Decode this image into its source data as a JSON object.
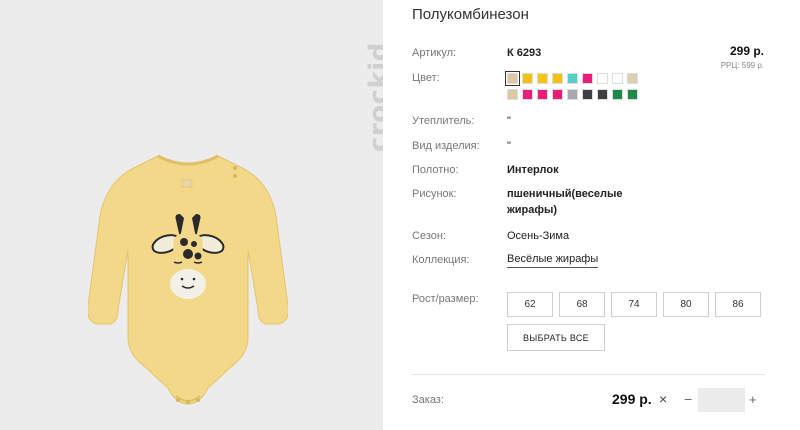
{
  "product": {
    "brand": "crockid",
    "title": "Полукомбинезон"
  },
  "price": {
    "value": "299 р.",
    "rrc": "РРЦ: 599 р."
  },
  "attributes": {
    "article_label": "Артикул:",
    "article_value": "К 6293",
    "color_label": "Цвет:",
    "insulation_label": "Утеплитель:",
    "insulation_value": "\"",
    "kind_label": "Вид изделия:",
    "kind_value": "\"",
    "fabric_label": "Полотно:",
    "fabric_value": "Интерлок",
    "print_label": "Рисунок:",
    "print_value_line1": "пшеничный(веселые",
    "print_value_line2": "жирафы)",
    "season_label": "Сезон:",
    "season_value": "Осень-Зима",
    "collection_label": "Коллекция:",
    "collection_value": "Весёлые жирафы",
    "size_label": "Рост/размер:"
  },
  "swatches": {
    "row1": [
      "#dcc9a4",
      "#f2c21b",
      "#f5c518",
      "#f4c20d",
      "#4fd1c5",
      "#e91e7a",
      "#ffffff",
      "#ffffff",
      "#ddd0b0"
    ],
    "row2": [
      "#dcc9a4",
      "#e91e7a",
      "#e91e7a",
      "#e91e7a",
      "#a7a9ac",
      "#3d3f44",
      "#3d3f44",
      "#1f8a48",
      "#1f8a48"
    ]
  },
  "sizes": [
    "62",
    "68",
    "74",
    "80",
    "86"
  ],
  "select_all_label": "ВЫБРАТЬ ВСЕ",
  "order": {
    "label": "Заказ:",
    "price": "299 р.",
    "times": "×",
    "minus": "−",
    "plus": "+",
    "quantity": ""
  }
}
